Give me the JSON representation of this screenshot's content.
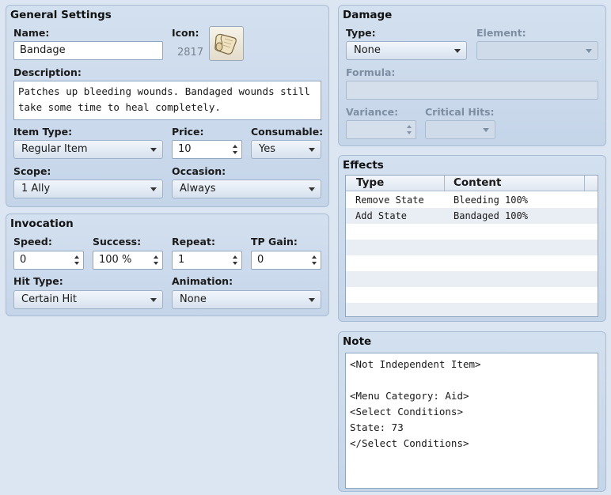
{
  "general": {
    "title": "General Settings",
    "name_label": "Name:",
    "name_value": "Bandage",
    "icon_label": "Icon:",
    "icon_index": "2817",
    "description_label": "Description:",
    "description_value": "Patches up bleeding wounds. Bandaged wounds still\ntake some time to heal completely.",
    "item_type_label": "Item Type:",
    "item_type_value": "Regular Item",
    "price_label": "Price:",
    "price_value": "10",
    "consumable_label": "Consumable:",
    "consumable_value": "Yes",
    "scope_label": "Scope:",
    "scope_value": "1 Ally",
    "occasion_label": "Occasion:",
    "occasion_value": "Always"
  },
  "invocation": {
    "title": "Invocation",
    "speed_label": "Speed:",
    "speed_value": "0",
    "success_label": "Success:",
    "success_value": "100 %",
    "repeat_label": "Repeat:",
    "repeat_value": "1",
    "tp_gain_label": "TP Gain:",
    "tp_gain_value": "0",
    "hit_type_label": "Hit Type:",
    "hit_type_value": "Certain Hit",
    "animation_label": "Animation:",
    "animation_value": "None"
  },
  "damage": {
    "title": "Damage",
    "type_label": "Type:",
    "type_value": "None",
    "element_label": "Element:",
    "element_value": "",
    "formula_label": "Formula:",
    "formula_value": "",
    "variance_label": "Variance:",
    "variance_value": "",
    "critical_label": "Critical Hits:",
    "critical_value": ""
  },
  "effects": {
    "title": "Effects",
    "columns": [
      "Type",
      "Content"
    ],
    "rows": [
      {
        "type": "Remove State",
        "content": "Bleeding 100%"
      },
      {
        "type": "Add State",
        "content": "Bandaged 100%"
      }
    ]
  },
  "note": {
    "title": "Note",
    "value": "<Not Independent Item>\n\n<Menu Category: Aid>\n<Select Conditions>\nState: 73\n</Select Conditions>"
  },
  "colors": {
    "panel_bg": "#c9d8ea",
    "panel_border": "#a8bcd4",
    "disabled_text": "#7e8ea2"
  },
  "icons": {
    "item_icon": "scroll-icon"
  }
}
